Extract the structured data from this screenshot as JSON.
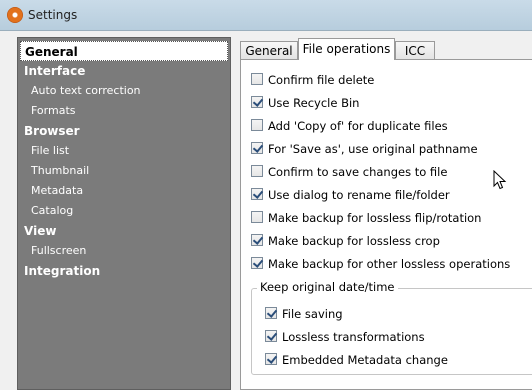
{
  "window": {
    "title": "Settings"
  },
  "sidebar": {
    "items": [
      {
        "label": "General",
        "level": "category",
        "selected": true
      },
      {
        "label": "Interface",
        "level": "category"
      },
      {
        "label": "Auto text correction",
        "level": "sub"
      },
      {
        "label": "Formats",
        "level": "sub"
      },
      {
        "label": "Browser",
        "level": "category"
      },
      {
        "label": "File list",
        "level": "sub"
      },
      {
        "label": "Thumbnail",
        "level": "sub"
      },
      {
        "label": "Metadata",
        "level": "sub"
      },
      {
        "label": "Catalog",
        "level": "sub"
      },
      {
        "label": "View",
        "level": "category"
      },
      {
        "label": "Fullscreen",
        "level": "sub"
      },
      {
        "label": "Integration",
        "level": "category"
      }
    ]
  },
  "tabs": [
    {
      "label": "General"
    },
    {
      "label": "File operations",
      "active": true
    },
    {
      "label": "ICC"
    }
  ],
  "options": [
    {
      "label": "Confirm file delete",
      "checked": false
    },
    {
      "label": "Use Recycle Bin",
      "checked": true
    },
    {
      "label": "Add 'Copy of' for duplicate files",
      "checked": false
    },
    {
      "label": "For 'Save as', use original pathname",
      "checked": true
    },
    {
      "label": "Confirm to save changes to file",
      "checked": false
    },
    {
      "label": "Use dialog to rename file/folder",
      "checked": true
    },
    {
      "label": "Make backup for lossless flip/rotation",
      "checked": false
    },
    {
      "label": "Make backup for lossless crop",
      "checked": true
    },
    {
      "label": "Make backup for other lossless operations",
      "checked": true
    }
  ],
  "date_group": {
    "label": "Keep original date/time",
    "options": [
      {
        "label": "File saving",
        "checked": true
      },
      {
        "label": "Lossless transformations",
        "checked": true
      },
      {
        "label": "Embedded Metadata change",
        "checked": true
      }
    ]
  }
}
